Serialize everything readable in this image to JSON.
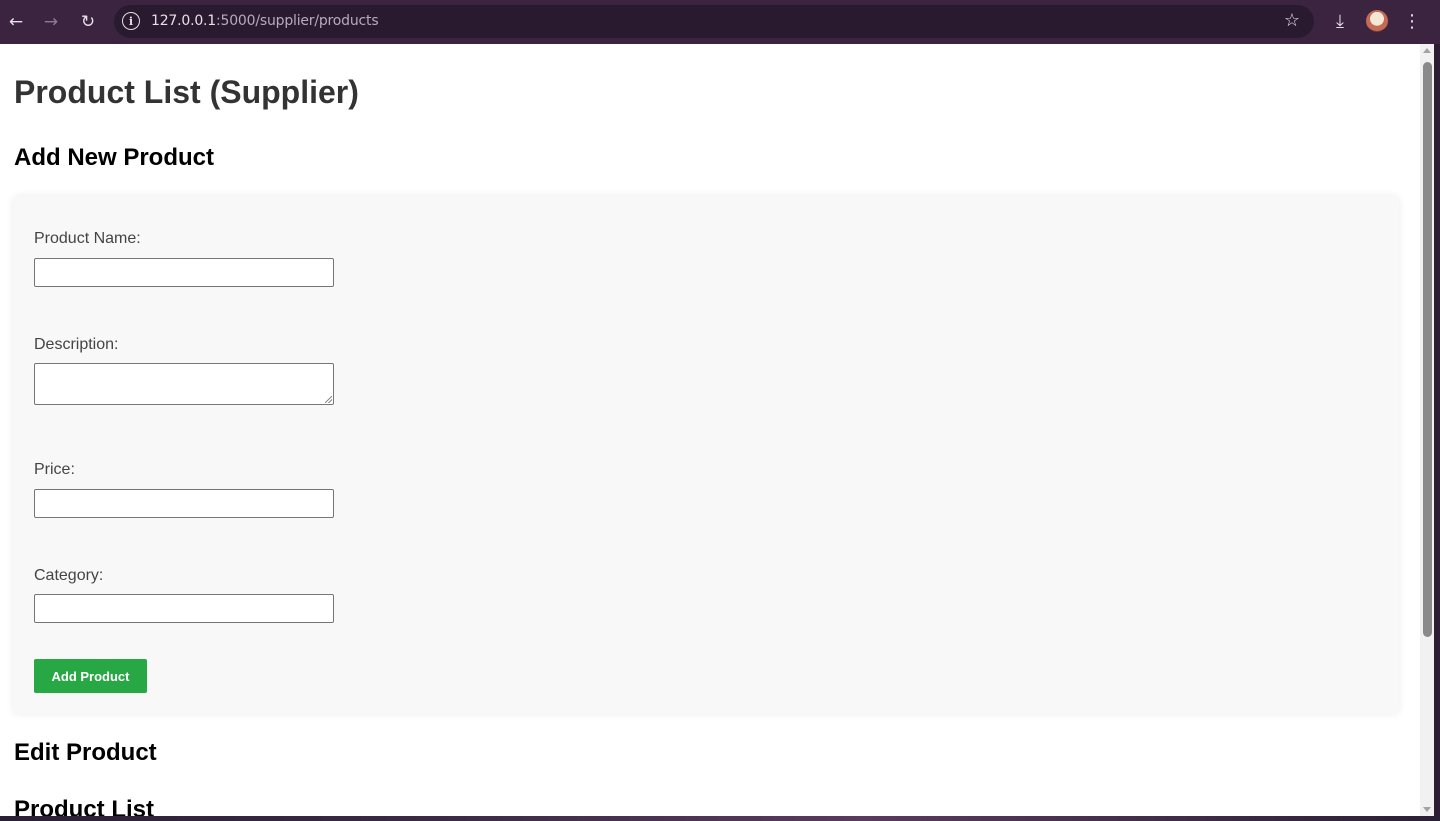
{
  "browser": {
    "url_host": "127.0.0.1",
    "url_rest": ":5000/supplier/products",
    "back_icon": "←",
    "forward_icon": "→",
    "reload_icon": "↻",
    "info_icon": "i",
    "star_icon": "☆",
    "download_icon": "⤓",
    "menu_icon": "⋮"
  },
  "page": {
    "title": "Product List (Supplier)",
    "add_heading": "Add New Product",
    "edit_heading": "Edit Product",
    "list_heading": "Product List"
  },
  "form": {
    "name_label": "Product Name:",
    "name_value": "",
    "description_label": "Description:",
    "description_value": "",
    "price_label": "Price:",
    "price_value": "",
    "category_label": "Category:",
    "category_value": "",
    "submit_label": "Add Product"
  },
  "colors": {
    "accent_button": "#28a745",
    "chrome_bg": "#3a2440"
  }
}
